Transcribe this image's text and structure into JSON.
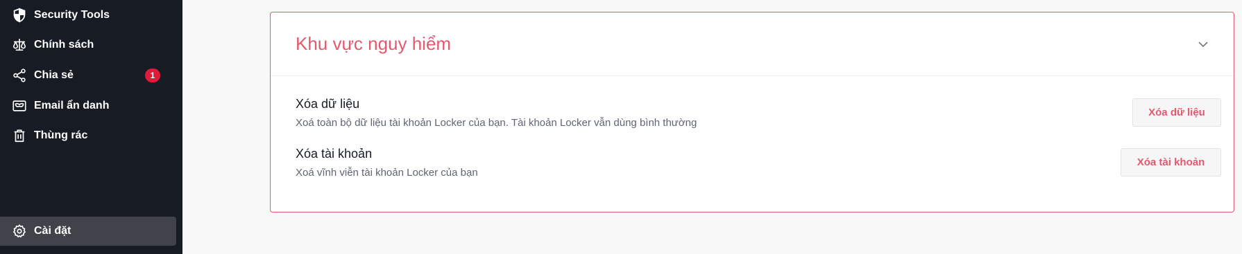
{
  "sidebar": {
    "items": [
      {
        "label": "Security Tools",
        "icon": "shield-icon"
      },
      {
        "label": "Chính sách",
        "icon": "scale-icon"
      },
      {
        "label": "Chia sẻ",
        "icon": "share-icon",
        "badge": "1"
      },
      {
        "label": "Email ẩn danh",
        "icon": "mask-mail-icon"
      },
      {
        "label": "Thùng rác",
        "icon": "trash-icon"
      }
    ],
    "settings": {
      "label": "Cài đặt",
      "icon": "gear-icon"
    }
  },
  "danger_zone": {
    "title": "Khu vực nguy hiểm",
    "rows": [
      {
        "title": "Xóa dữ liệu",
        "description": "Xoá toàn bộ dữ liệu tài khoản Locker của bạn. Tài khoản Locker vẫn dùng bình thường",
        "button": "Xóa dữ liệu"
      },
      {
        "title": "Xóa tài khoản",
        "description": "Xoá vĩnh viễn tài khoản Locker của bạn",
        "button": "Xóa tài khoản"
      }
    ]
  },
  "colors": {
    "sidebar_bg": "#161b24",
    "active_item_bg": "#40434a",
    "danger": "#e5576d",
    "badge": "#e01b3a"
  }
}
